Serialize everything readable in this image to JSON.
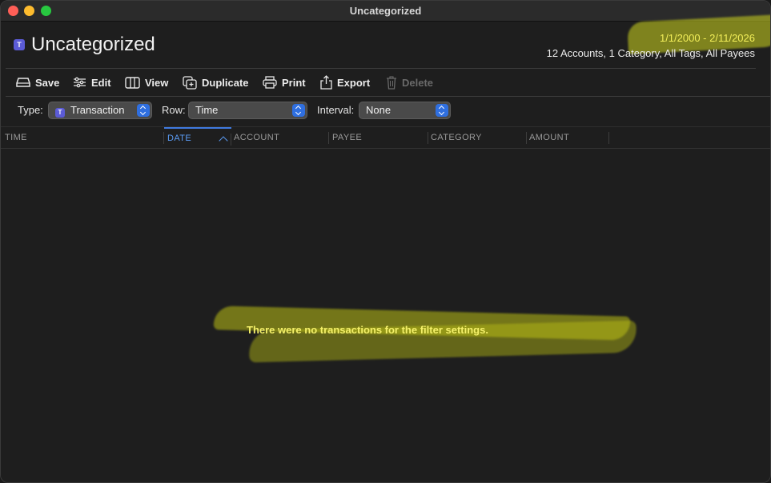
{
  "window": {
    "title": "Uncategorized"
  },
  "header": {
    "badge": "T",
    "title": "Uncategorized",
    "date_range": "1/1/2000 - 2/11/2026",
    "summary": "12 Accounts, 1 Category, All Tags, All Payees"
  },
  "toolbar": {
    "save": "Save",
    "edit": "Edit",
    "view": "View",
    "duplicate": "Duplicate",
    "print": "Print",
    "export": "Export",
    "delete": "Delete"
  },
  "filters": {
    "type_label": "Type:",
    "type_value": "Transaction",
    "type_badge": "T",
    "row_label": "Row:",
    "row_value": "Time",
    "interval_label": "Interval:",
    "interval_value": "None"
  },
  "table": {
    "columns": [
      "TIME",
      "DATE",
      "ACCOUNT",
      "PAYEE",
      "CATEGORY",
      "AMOUNT"
    ],
    "sorted_column": "DATE",
    "sort_direction": "ascending",
    "empty_message": "There were no transactions for the filter settings."
  },
  "colors": {
    "highlight": "#cfd61e",
    "accent": "#2f6fe0",
    "badge": "#5b5bd6"
  }
}
